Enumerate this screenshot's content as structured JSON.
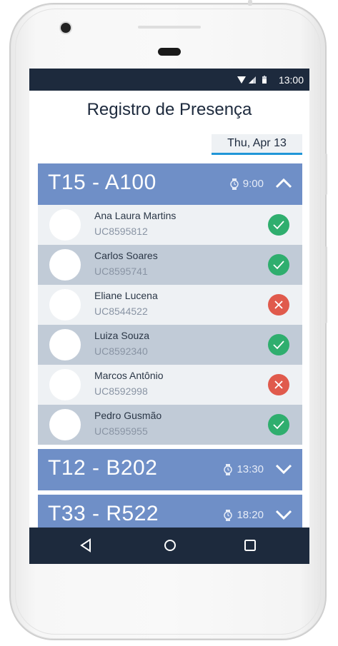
{
  "status_bar": {
    "time": "13:00",
    "icons": [
      "wifi-icon",
      "signal-icon",
      "battery-icon"
    ]
  },
  "page": {
    "title": "Registro de Presença",
    "date": "Thu, Apr 13"
  },
  "classes": [
    {
      "name": "T15 - A100",
      "time": "9:00",
      "expanded": true,
      "students": [
        {
          "name": "Ana Laura Martins",
          "id": "UC8595812",
          "present": true
        },
        {
          "name": "Carlos Soares",
          "id": "UC8595741",
          "present": true
        },
        {
          "name": "Eliane Lucena",
          "id": "UC8544522",
          "present": false
        },
        {
          "name": "Luiza Souza",
          "id": "UC8592340",
          "present": true
        },
        {
          "name": "Marcos Antônio",
          "id": "UC8592998",
          "present": false
        },
        {
          "name": "Pedro Gusmão",
          "id": "UC8595955",
          "present": true
        }
      ]
    },
    {
      "name": "T12 - B202",
      "time": "13:30",
      "expanded": false
    },
    {
      "name": "T33 - R522",
      "time": "18:20",
      "expanded": false
    }
  ],
  "colors": {
    "header_bar": "#1d2a3d",
    "class_header": "#6f8fc7",
    "present": "#2fae6e",
    "absent": "#e05a4c",
    "date_underline": "#2196d8"
  },
  "nav_bar": {
    "icons": [
      "back-icon",
      "home-icon",
      "recents-icon"
    ]
  }
}
